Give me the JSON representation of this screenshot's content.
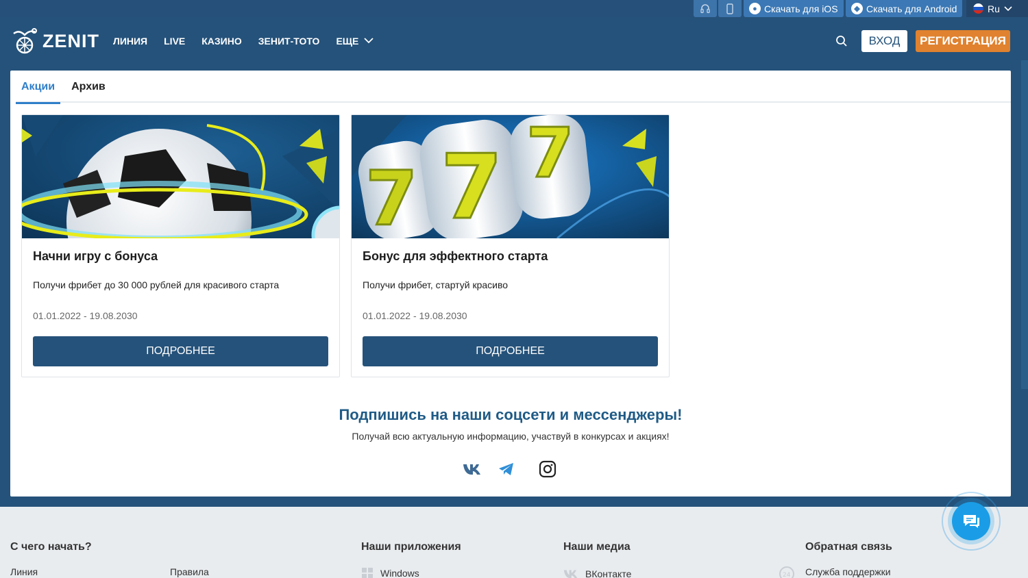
{
  "topbar": {
    "support_icon": "headset-icon",
    "mobile_icon": "phone-icon",
    "ios_label": "Скачать для iOS",
    "android_label": "Скачать для Android",
    "language": "Ru"
  },
  "header": {
    "logo_text": "ZENIT",
    "nav": [
      "ЛИНИЯ",
      "LIVE",
      "КАЗИНО",
      "ЗЕНИТ-ТОТО",
      "ЕЩЕ"
    ],
    "login": "ВХОД",
    "register": "РЕГИСТРАЦИЯ"
  },
  "tabs": [
    "Акции",
    "Архив"
  ],
  "cards": [
    {
      "title": "Начни игру с бонуса",
      "description": "Получи фрибет до 30 000 рублей для красивого старта",
      "dates": "01.01.2022 - 19.08.2030",
      "button": "ПОДРОБНЕЕ"
    },
    {
      "title": "Бонус для эффектного старта",
      "description": "Получи фрибет, стартуй красиво",
      "dates": "01.01.2022 - 19.08.2030",
      "button": "ПОДРОБНЕЕ"
    }
  ],
  "social": {
    "title": "Подпишись на наши соцсети и мессенджеры!",
    "subtitle": "Получай всю актуальную информацию, участвуй в конкурсах и акциях!",
    "icons": [
      "vk-icon",
      "telegram-icon",
      "instagram-icon"
    ]
  },
  "footer": {
    "col1_title": "С чего начать?",
    "col1_links": [
      "Линия",
      "Правила"
    ],
    "col2_title": "Наши приложения",
    "col2_links": [
      "Windows"
    ],
    "col3_title": "Наши медиа",
    "col3_links": [
      "ВКонтакте"
    ],
    "col4_title": "Обратная связь",
    "col4_links": [
      "Служба поддержки"
    ]
  },
  "colors": {
    "brand_blue": "#25527a",
    "accent_orange": "#e0822f",
    "tab_active": "#2f7fc9"
  }
}
